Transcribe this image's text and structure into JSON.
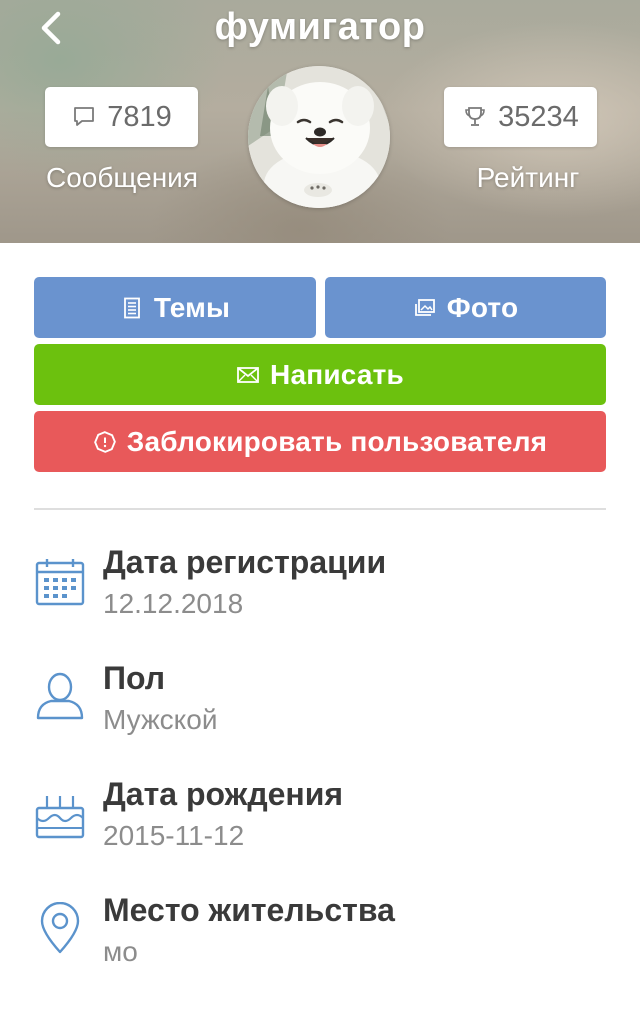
{
  "header": {
    "title": "фумигатор",
    "messages": {
      "count": "7819",
      "label": "Сообщения",
      "icon": "speech-bubble-icon"
    },
    "rating": {
      "count": "35234",
      "label": "Рейтинг",
      "icon": "trophy-icon"
    },
    "back_icon": "chevron-left-icon"
  },
  "actions": {
    "topics": {
      "label": "Темы",
      "icon": "document-icon",
      "color": "#6a93cf"
    },
    "photo": {
      "label": "Фото",
      "icon": "photos-icon",
      "color": "#6a93cf"
    },
    "write": {
      "label": "Написать",
      "icon": "envelope-icon",
      "color": "#6cc10e"
    },
    "block": {
      "label": "Заблокировать пользователя",
      "icon": "alert-octagon-icon",
      "color": "#e8595a"
    }
  },
  "info": [
    {
      "title": "Дата регистрации",
      "value": "12.12.2018",
      "icon": "calendar-icon"
    },
    {
      "title": "Пол",
      "value": "Мужской",
      "icon": "user-icon"
    },
    {
      "title": "Дата рождения",
      "value": "2015-11-12",
      "icon": "cake-icon"
    },
    {
      "title": "Место жительства",
      "value": "мо",
      "icon": "location-pin-icon"
    }
  ],
  "colors": {
    "icon_blue": "#5b93cc",
    "divider": "#dedede"
  }
}
